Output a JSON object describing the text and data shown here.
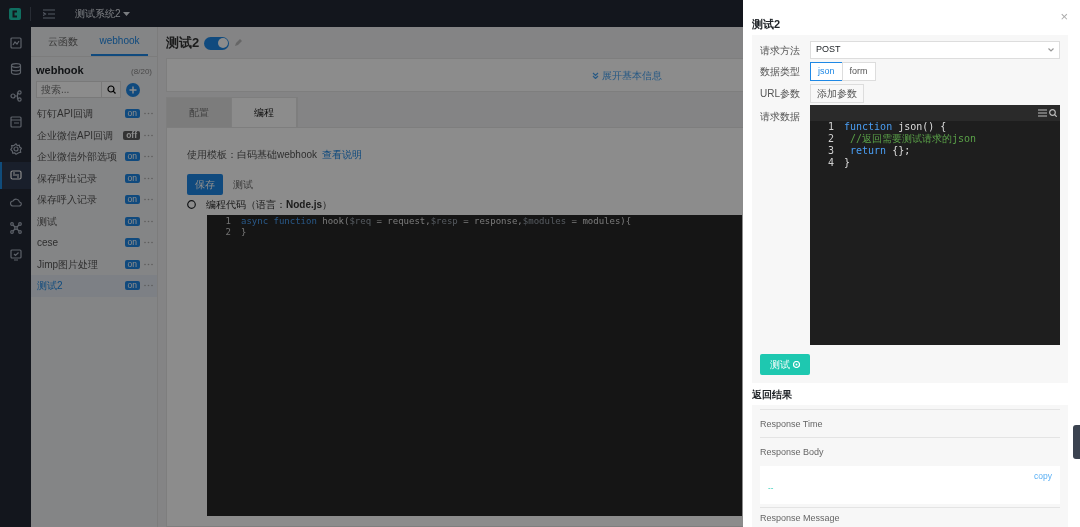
{
  "topbar": {
    "system": "测试系统2"
  },
  "rail": [
    {
      "selected": false
    },
    {
      "selected": false
    },
    {
      "selected": false
    },
    {
      "selected": false
    },
    {
      "selected": false
    },
    {
      "selected": true
    },
    {
      "selected": false
    },
    {
      "selected": false
    },
    {
      "selected": false
    }
  ],
  "panel": {
    "tabs": [
      {
        "label": "云函数",
        "selected": false
      },
      {
        "label": "webhook",
        "selected": true
      }
    ],
    "title": "webhook",
    "count": "(8/20)",
    "search": {
      "placeholder": "搜索..."
    },
    "items": [
      {
        "name": "钉钉API回调",
        "badge": "on",
        "enabled": true,
        "selected": false
      },
      {
        "name": "企业微信API回调",
        "badge": "off",
        "enabled": false,
        "selected": false
      },
      {
        "name": "企业微信外部选项",
        "badge": "on",
        "enabled": true,
        "selected": false
      },
      {
        "name": "保存呼出记录",
        "badge": "on",
        "enabled": true,
        "selected": false
      },
      {
        "name": "保存呼入记录",
        "badge": "on",
        "enabled": true,
        "selected": false
      },
      {
        "name": "测试",
        "badge": "on",
        "enabled": true,
        "selected": false
      },
      {
        "name": "cese",
        "badge": "on",
        "enabled": true,
        "selected": false
      },
      {
        "name": "Jimp图片处理",
        "badge": "on",
        "enabled": true,
        "selected": false
      },
      {
        "name": "测试2",
        "badge": "on",
        "enabled": true,
        "selected": true
      }
    ]
  },
  "main": {
    "title": "测试2",
    "enabled": true,
    "expand_link": "展开基本信息",
    "tabs": [
      {
        "label": "配置",
        "selected": false
      },
      {
        "label": "编程",
        "selected": true
      }
    ],
    "template_label": "使用模板：白码基础webhook",
    "template_link": "查看说明",
    "save_button": "保存",
    "test_link": "测试",
    "code_label": "编程代码（语言：**Node.js**）",
    "code": [
      {
        "number": "1",
        "tokens": [
          {
            "text": "async function",
            "kind": "keyword"
          },
          {
            "text": " hook(",
            "kind": "plain"
          },
          {
            "text": "$req",
            "kind": "param"
          },
          {
            "text": " = request,",
            "kind": "plain"
          },
          {
            "text": "$resp",
            "kind": "param"
          },
          {
            "text": " = response,",
            "kind": "plain"
          },
          {
            "text": "$modules",
            "kind": "param"
          },
          {
            "text": " = modules){",
            "kind": "plain"
          }
        ]
      },
      {
        "number": "2",
        "tokens": [
          {
            "text": "}",
            "kind": "plain"
          }
        ]
      }
    ]
  },
  "drawer": {
    "title": "测试2",
    "close": "×",
    "method_label": "请求方法",
    "method": "POST",
    "type_label": "数据类型",
    "types": [
      {
        "label": "json",
        "selected": true
      },
      {
        "label": "form",
        "selected": false
      }
    ],
    "url_label": "URL参数",
    "add_param": "添加参数",
    "data_label": "请求数据",
    "code": [
      {
        "number": "1",
        "tokens": [
          {
            "text": "function",
            "kind": "keyword"
          },
          {
            "text": " json() {",
            "kind": "plain"
          }
        ]
      },
      {
        "number": "2",
        "tokens": [
          {
            "text": " //返回需要测试请求的json",
            "kind": "comment"
          }
        ]
      },
      {
        "number": "3",
        "tokens": [
          {
            "text": " return",
            "kind": "keyword"
          },
          {
            "text": " {};",
            "kind": "plain"
          }
        ]
      },
      {
        "number": "4",
        "tokens": [
          {
            "text": "}",
            "kind": "plain"
          }
        ]
      }
    ],
    "test_button": "测试",
    "result_title": "返回结果",
    "response_time": "Response Time",
    "response_body": "Response Body",
    "copy": "copy",
    "body_value": "--",
    "response_message": "Response Message"
  }
}
